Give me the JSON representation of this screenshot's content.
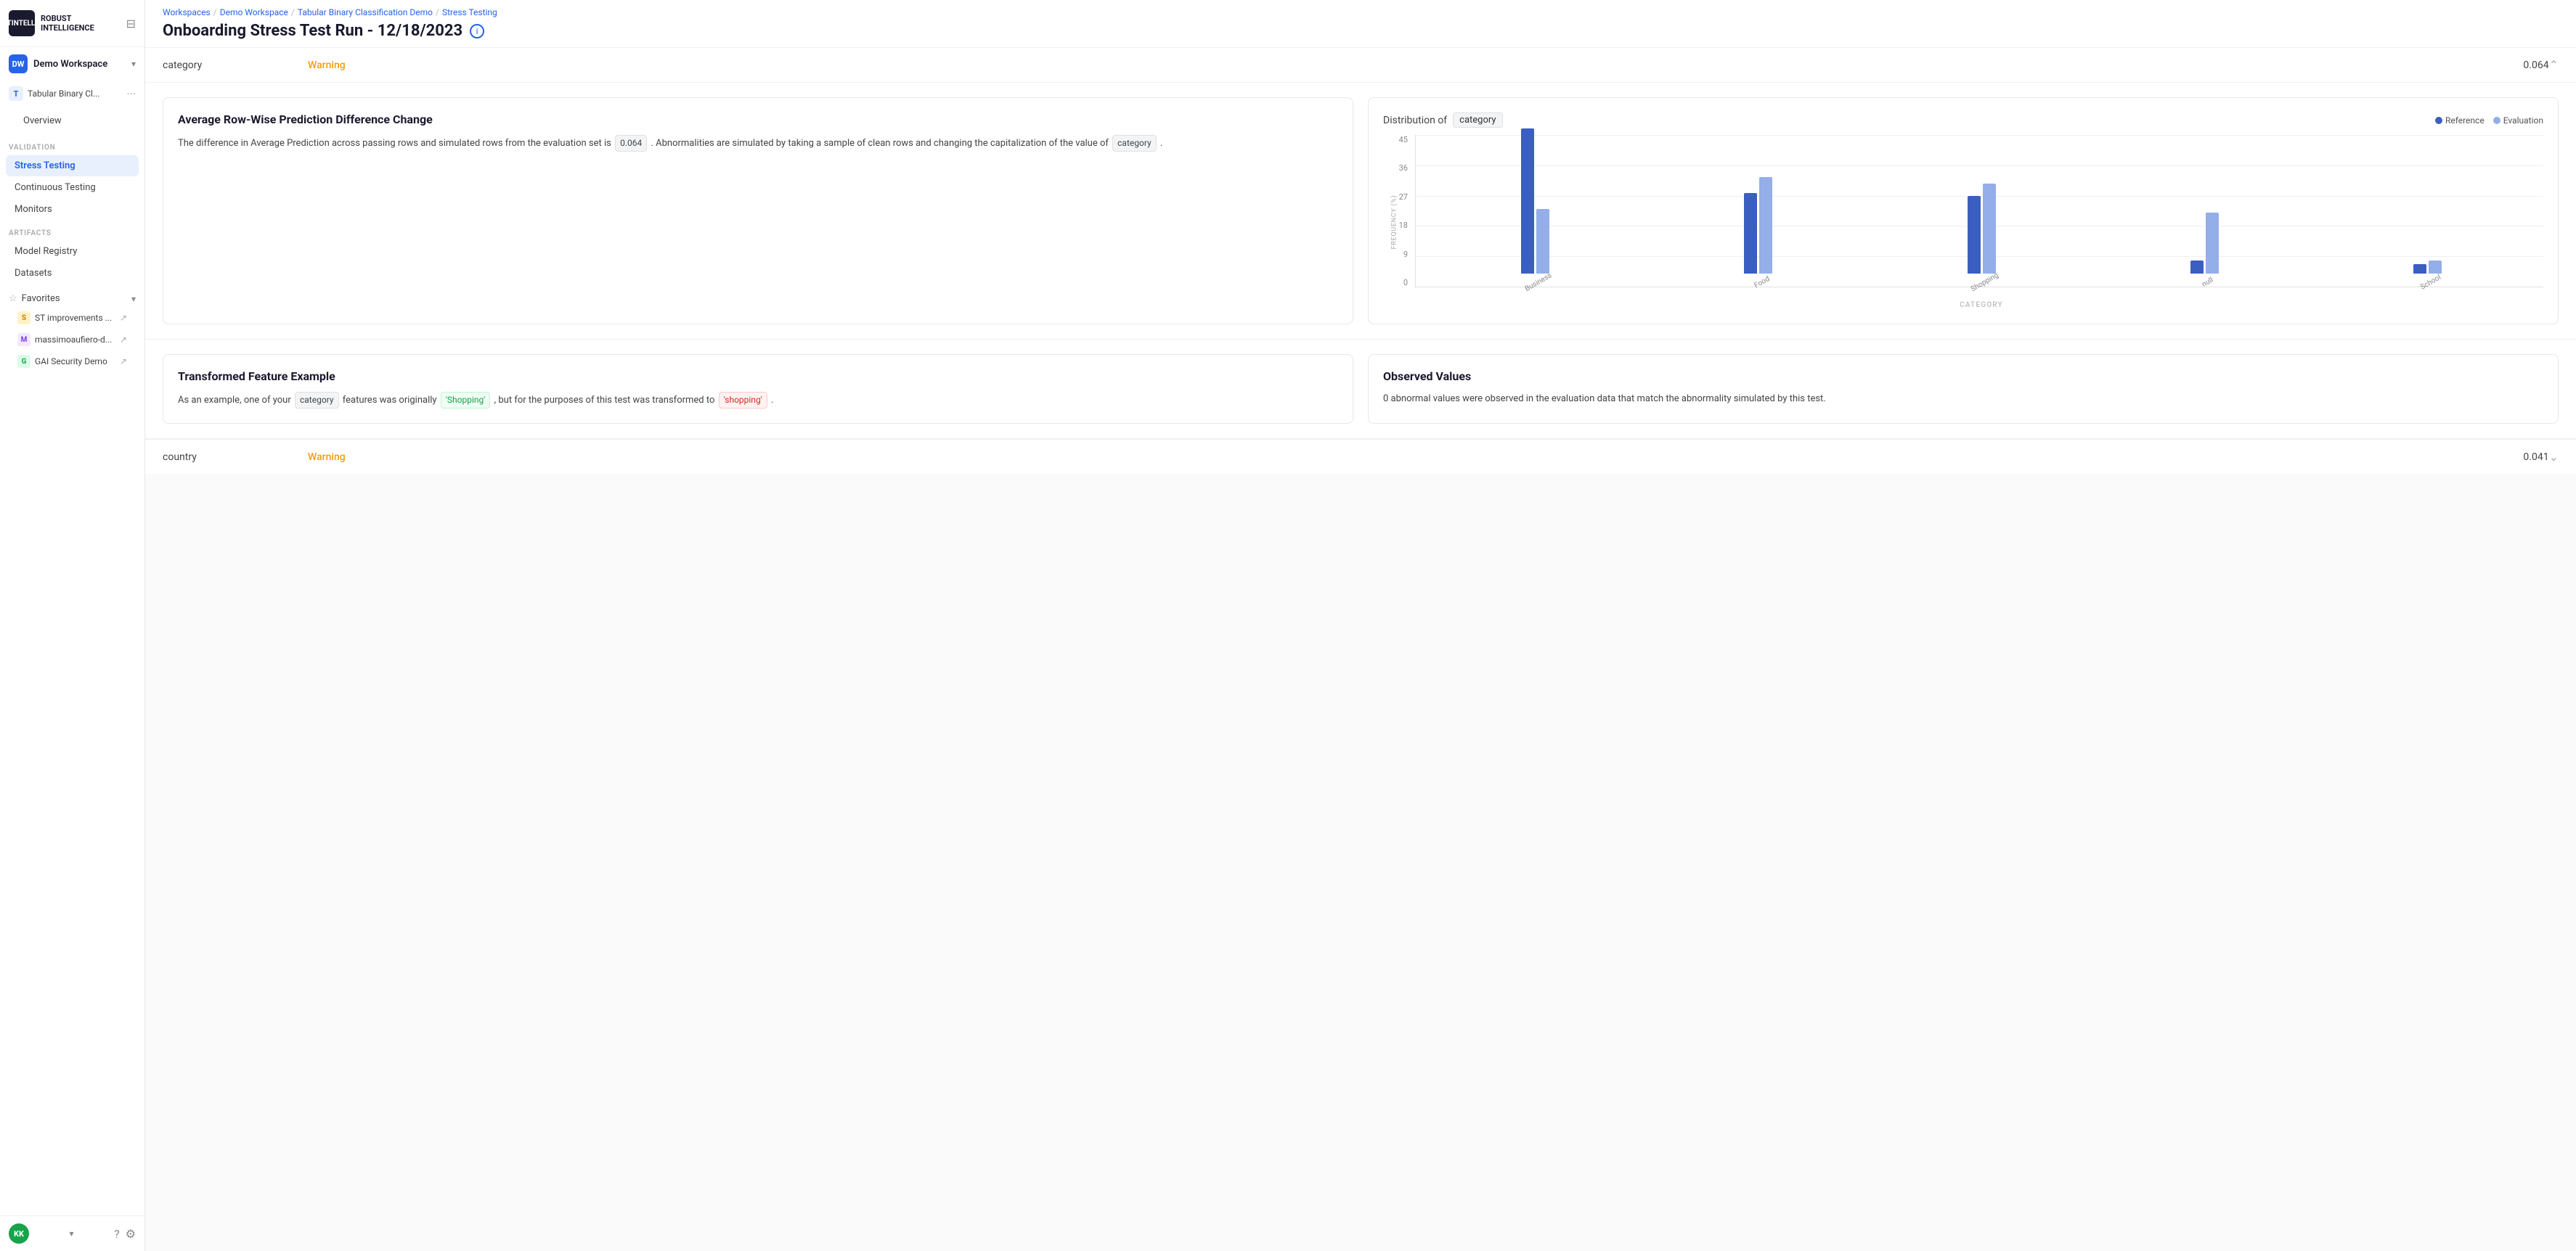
{
  "logo": {
    "line1": "ROBUST",
    "line2": "INTELLIGENCE"
  },
  "workspace": {
    "initials": "DW",
    "name": "Demo Workspace"
  },
  "project": {
    "letter": "T",
    "name": "Tabular Binary Cl...",
    "full_name": "Tabular Binary Classification Demo"
  },
  "nav": {
    "overview": "Overview",
    "validation_label": "VALIDATION",
    "stress_testing": "Stress Testing",
    "continuous_testing": "Continuous Testing",
    "monitors": "Monitors",
    "artifacts_label": "ARTIFACTS",
    "model_registry": "Model Registry",
    "datasets": "Datasets"
  },
  "favorites": {
    "label": "Favorites",
    "items": [
      {
        "letter": "S",
        "name": "ST improvements ...",
        "bg": "#fef3c7",
        "color": "#d97706"
      },
      {
        "letter": "M",
        "name": "massimoaufiero-d...",
        "bg": "#f3e8ff",
        "color": "#7c3aed"
      },
      {
        "letter": "G",
        "name": "GAI Security Demo",
        "bg": "#dcfce7",
        "color": "#16a34a"
      }
    ]
  },
  "user": {
    "initials": "KK"
  },
  "breadcrumb": {
    "workspaces": "Workspaces",
    "demo_workspace": "Demo Workspace",
    "project": "Tabular Binary Classification Demo",
    "current": "Stress Testing"
  },
  "page": {
    "title": "Onboarding Stress Test Run - 12/18/2023"
  },
  "category_row": {
    "feature": "category",
    "status": "Warning",
    "score": "0.064"
  },
  "chart": {
    "title_prefix": "Distribution of",
    "feature": "category",
    "legend_reference": "Reference",
    "legend_evaluation": "Evaluation",
    "y_title": "FREQUENCY (%)",
    "x_title": "CATEGORY",
    "y_labels": [
      "45",
      "36",
      "27",
      "18",
      "9",
      "0"
    ],
    "bars": [
      {
        "label": "Business",
        "ref_pct": 45,
        "eval_pct": 20
      },
      {
        "label": "Food",
        "ref_pct": 25,
        "eval_pct": 30
      },
      {
        "label": "Shopping",
        "ref_pct": 24,
        "eval_pct": 28
      },
      {
        "label": "null",
        "ref_pct": 4,
        "eval_pct": 19
      },
      {
        "label": "School",
        "ref_pct": 3,
        "eval_pct": 4
      }
    ],
    "max_pct": 45
  },
  "avg_row_wise": {
    "title": "Average Row-Wise Prediction Difference Change",
    "desc_part1": "The difference in Average Prediction across passing rows and simulated rows from the evaluation set is",
    "score": "0.064",
    "desc_part2": ". Abnormalities are simulated by taking a sample of clean rows and changing the capitalization of the value of",
    "feature": "category",
    "desc_part3": "."
  },
  "transformed_feature": {
    "title": "Transformed Feature Example",
    "desc_part1": "As an example, one of your",
    "feature": "category",
    "desc_part2": "features was originally",
    "original": "'Shopping'",
    "desc_part3": ", but for the purposes of this test was transformed to",
    "transformed": "'shopping'",
    "desc_part4": "."
  },
  "observed_values": {
    "title": "Observed Values",
    "desc": "0 abnormal values were observed in the evaluation data that match the abnormality simulated by this test."
  },
  "country_row": {
    "feature": "country",
    "status": "Warning",
    "score": "0.041"
  }
}
